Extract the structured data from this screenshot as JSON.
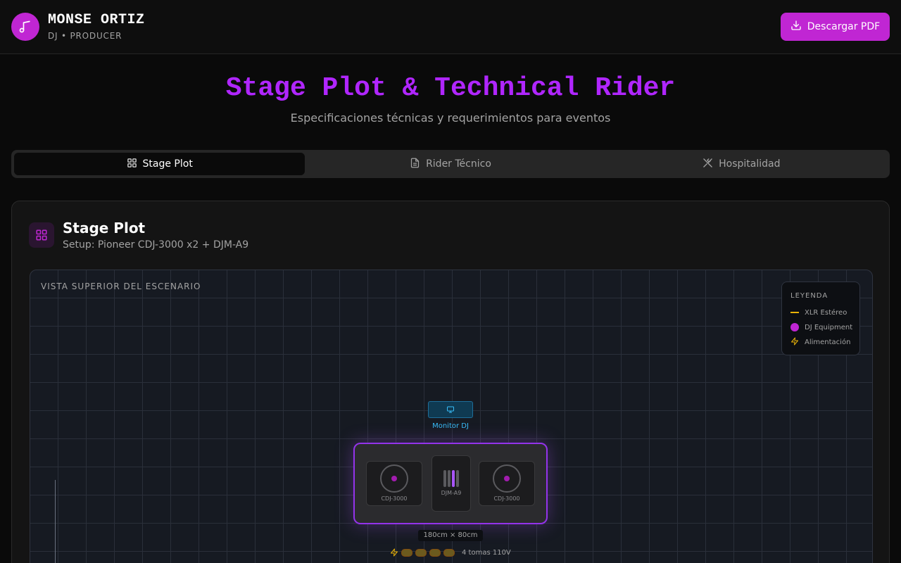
{
  "header": {
    "name": "MONSE ORTIZ",
    "subtitle": "DJ • PRODUCER",
    "pdf_button": "Descargar PDF"
  },
  "hero": {
    "title": "Stage Plot & Technical Rider",
    "subtitle": "Especificaciones técnicas y requerimientos para eventos"
  },
  "tabs": [
    {
      "label": "Stage Plot",
      "active": true,
      "icon": "grid-icon"
    },
    {
      "label": "Rider Técnico",
      "active": false,
      "icon": "document-icon"
    },
    {
      "label": "Hospitalidad",
      "active": false,
      "icon": "utensils-icon"
    }
  ],
  "card": {
    "title": "Stage Plot",
    "subtitle": "Setup: Pioneer CDJ-3000 x2 + DJM-A9"
  },
  "stage": {
    "label": "VISTA SUPERIOR DEL ESCENARIO",
    "legend": {
      "title": "LEYENDA",
      "items": [
        "XLR Estéreo",
        "DJ Equipment",
        "Alimentación"
      ]
    },
    "monitor_label": "Monitor DJ",
    "cdj_left": "CDJ-3000",
    "mixer": "DJM-A9",
    "cdj_right": "CDJ-3000",
    "dimensions": "180cm × 80cm",
    "power": "4 tomas 110V"
  },
  "colors": {
    "accent": "#c026d3",
    "title": "#b026ff",
    "monitor": "#38bdf8",
    "xlr": "#eab308"
  }
}
